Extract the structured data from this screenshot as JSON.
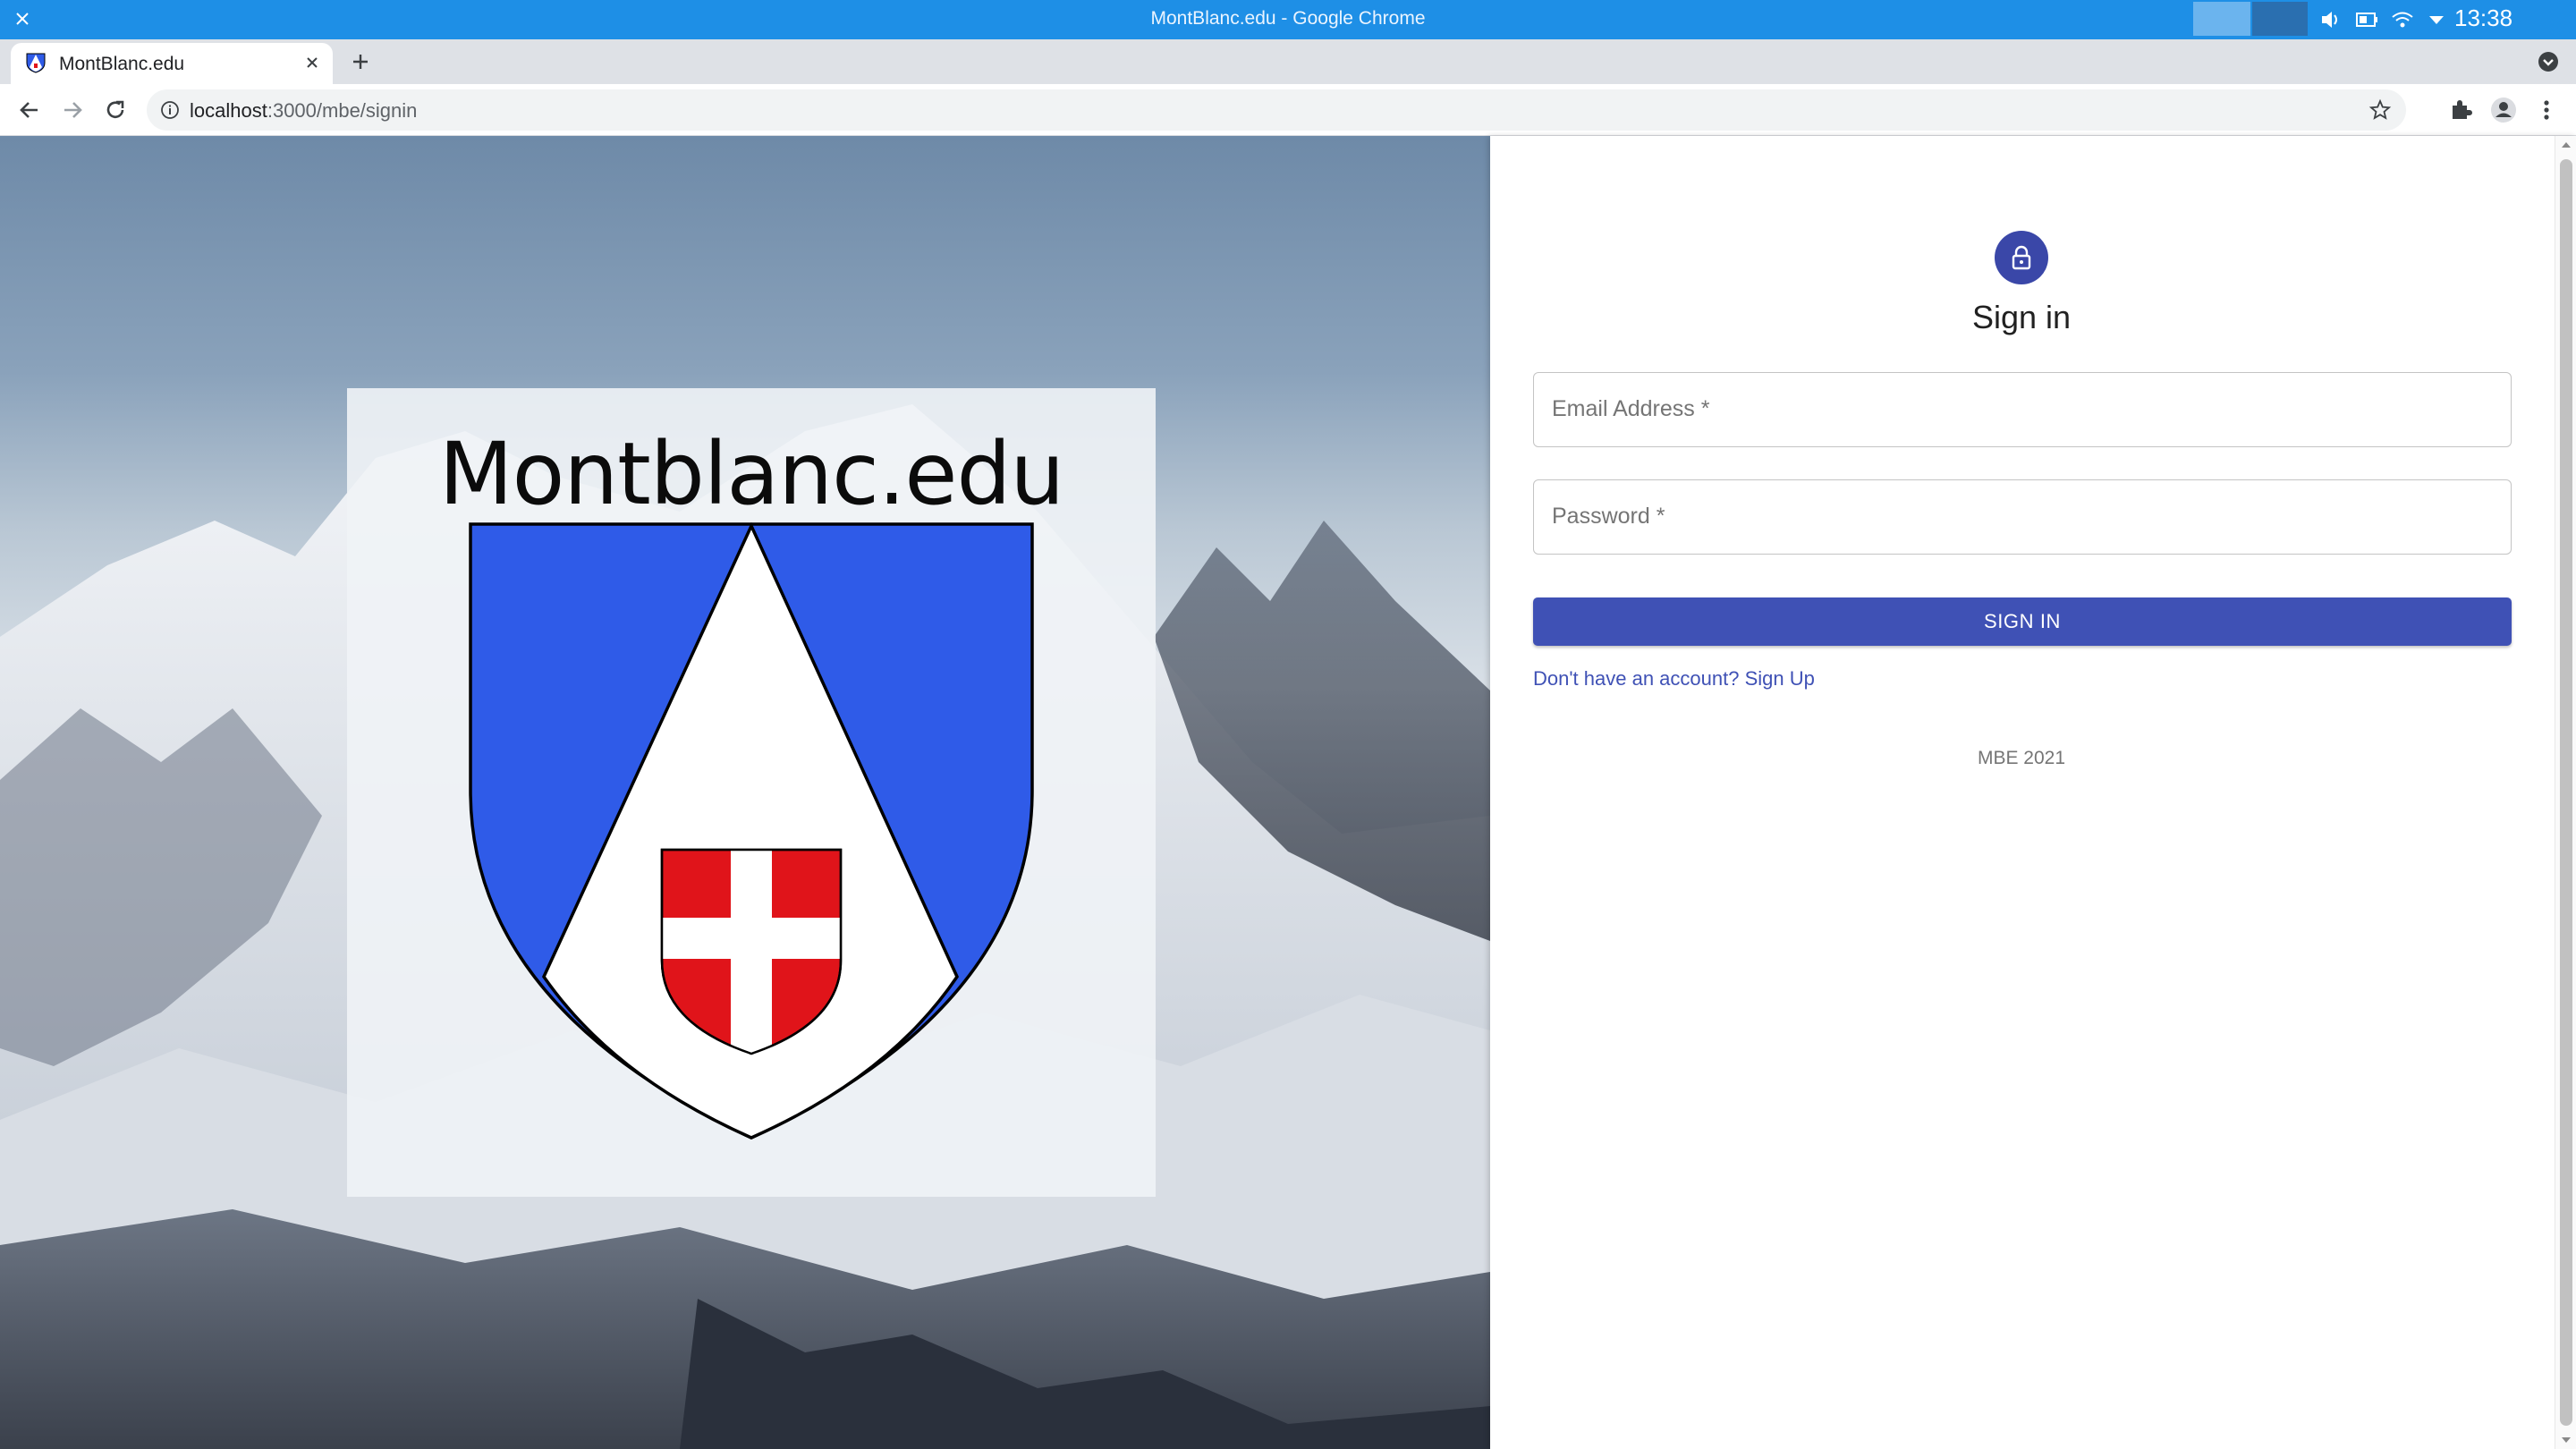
{
  "window": {
    "title": "MontBlanc.edu - Google Chrome",
    "clock": "13:38",
    "tray_icons": [
      "volume-icon",
      "battery-icon",
      "wifi-icon",
      "dropdown-arrow-icon"
    ]
  },
  "browser": {
    "tab": {
      "title": "MontBlanc.edu",
      "favicon": "montblanc-favicon-icon"
    },
    "address": {
      "host": "localhost",
      "path": ":3000/mbe/signin"
    }
  },
  "hero": {
    "logo_text": "Montblanc.edu",
    "colors": {
      "shield_blue": "#2f5be8",
      "cross_red": "#e0141a",
      "card_bg": "#eef1f4"
    }
  },
  "signin": {
    "title": "Sign in",
    "email_label": "Email Address *",
    "password_label": "Password *",
    "submit_label": "SIGN IN",
    "signup_link": "Don't have an account? Sign Up",
    "copyright": "MBE 2021",
    "colors": {
      "primary": "#3f51b5",
      "avatar": "#3a47a8"
    }
  }
}
